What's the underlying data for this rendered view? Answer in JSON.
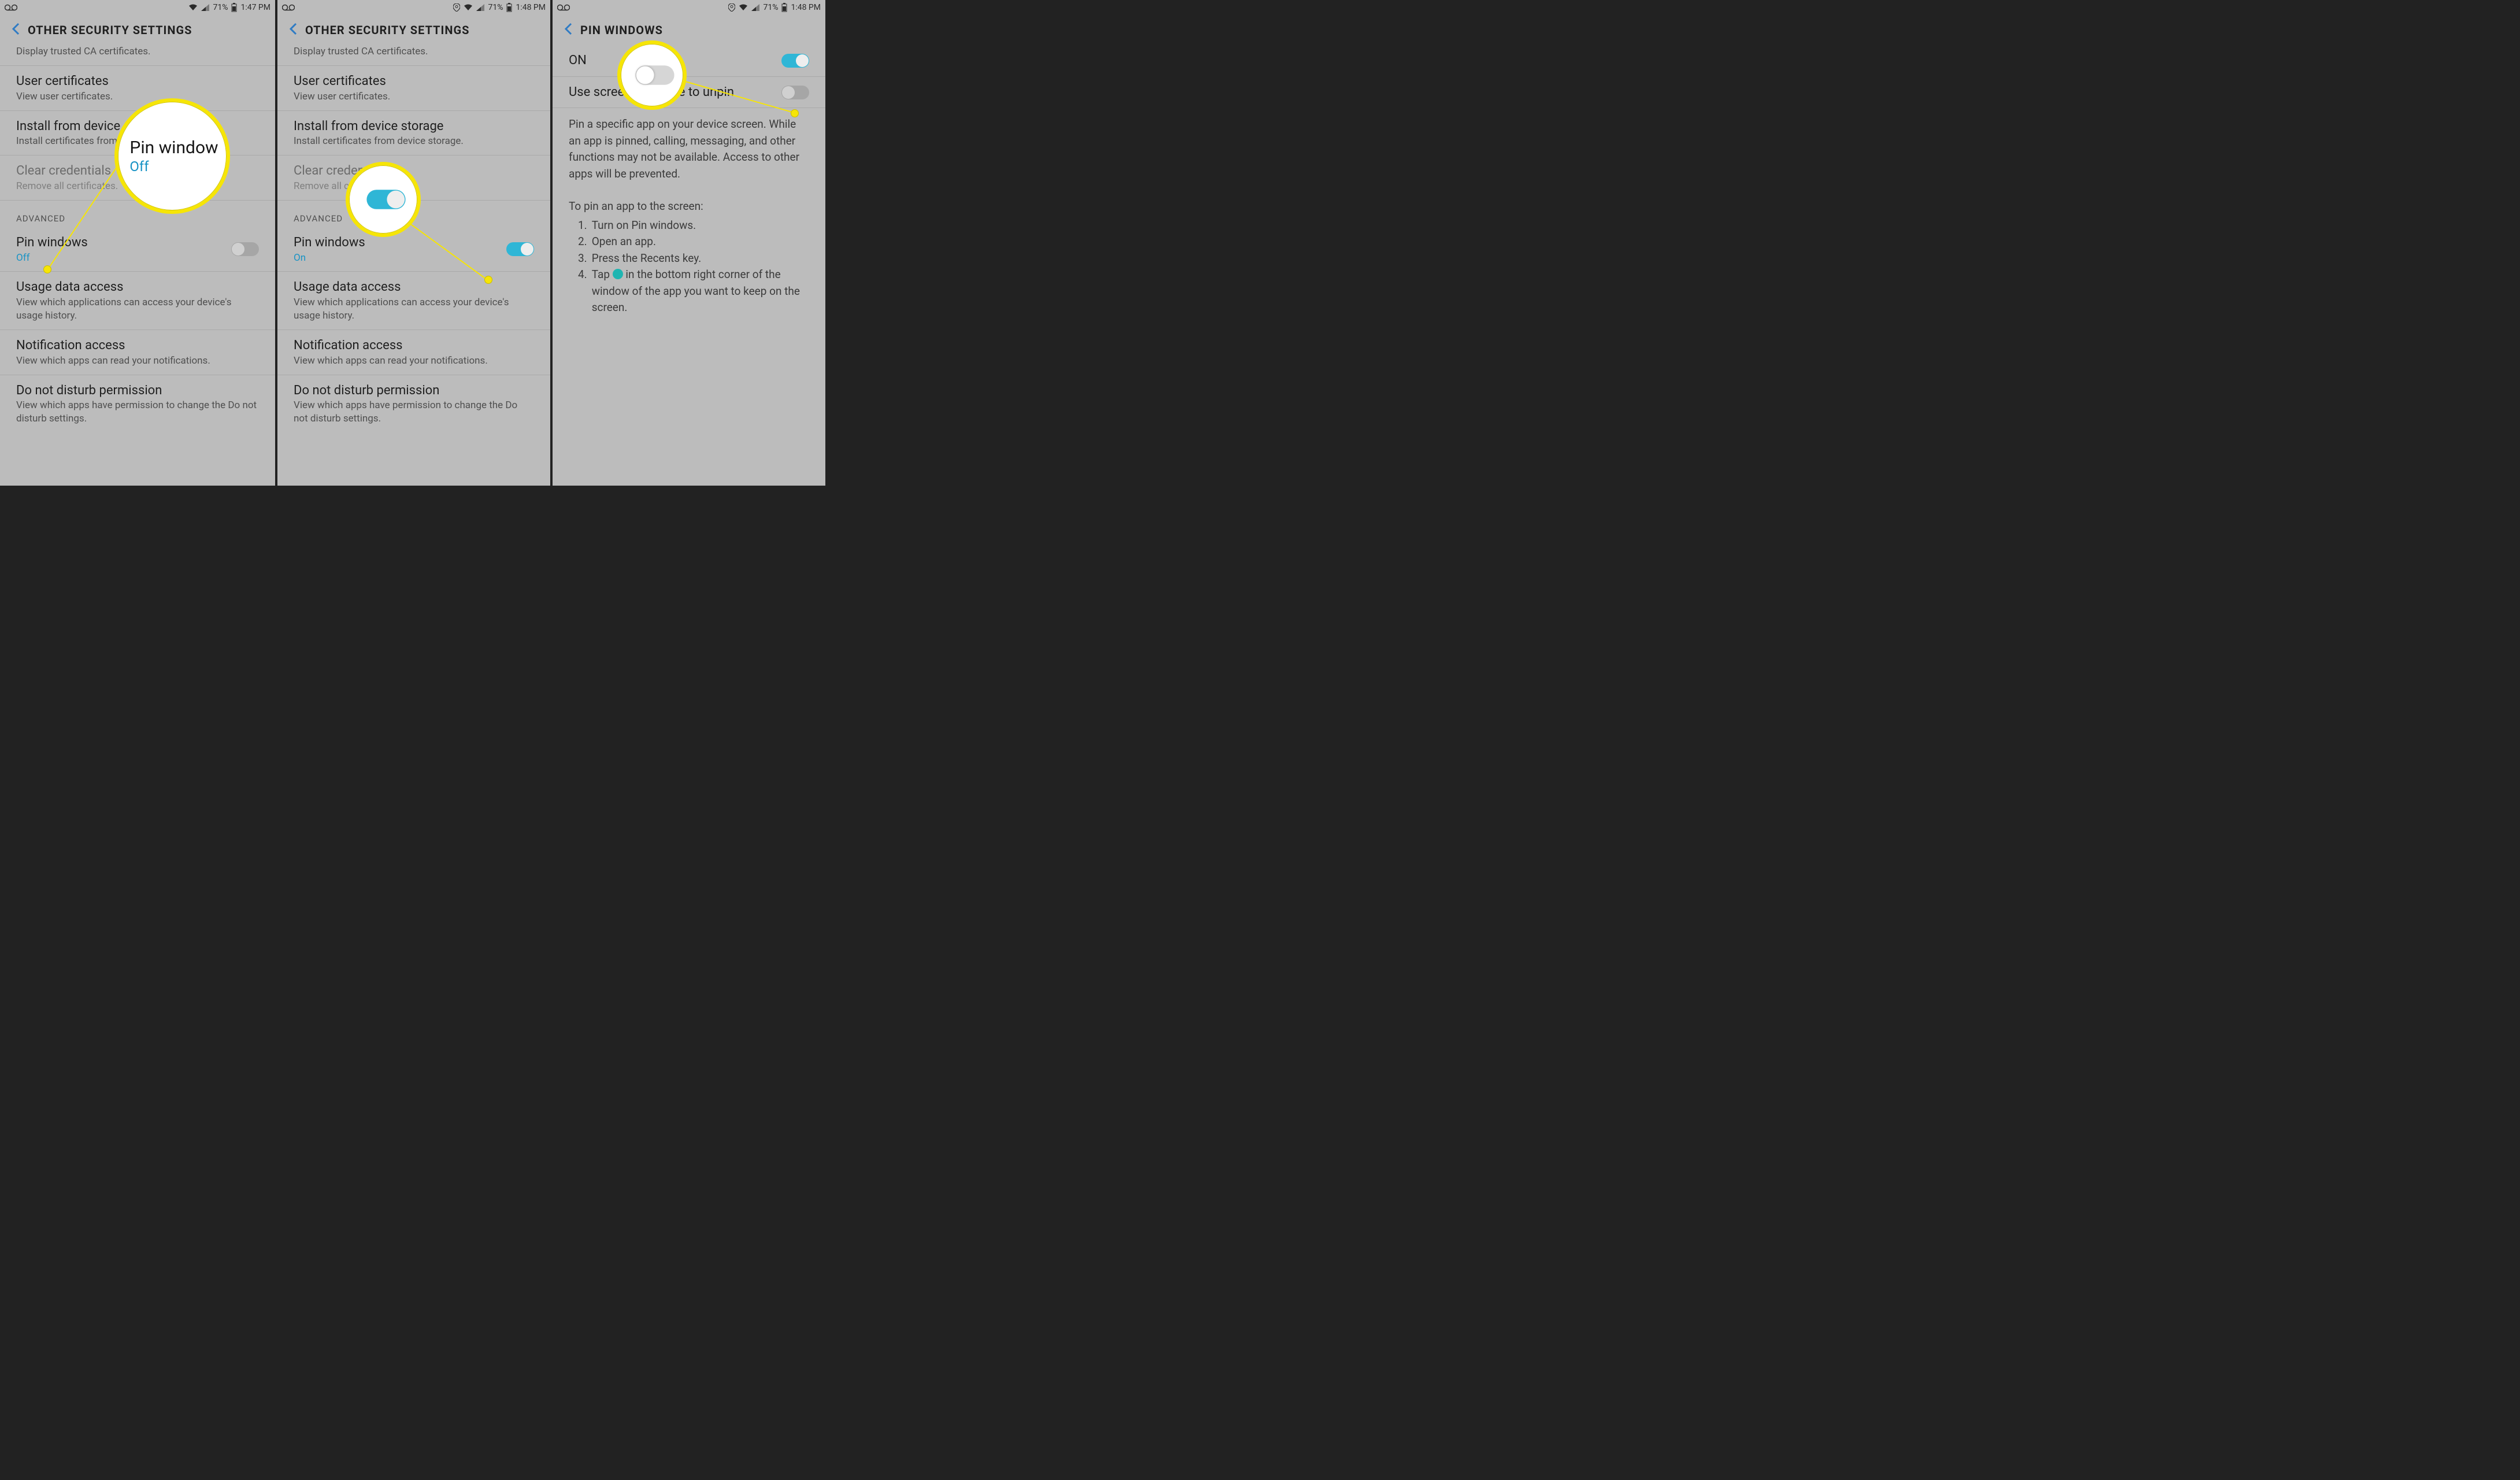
{
  "panels": [
    {
      "status": {
        "battery": "71%",
        "time": "1:47 PM",
        "show_location": false
      },
      "header": "OTHER SECURITY SETTINGS",
      "cut_sub": "Display trusted CA certificates.",
      "items": {
        "user_cert": {
          "title": "User certificates",
          "sub": "View user certificates."
        },
        "install": {
          "title": "Install from device storage",
          "sub": "Install certificates from device storage."
        },
        "clear": {
          "title": "Clear credentials",
          "sub": "Remove all certificates."
        },
        "section": "ADVANCED",
        "pin": {
          "title": "Pin windows",
          "sub": "Off",
          "on": false
        },
        "usage": {
          "title": "Usage data access",
          "sub": "View which applications can access your device's usage history."
        },
        "notif": {
          "title": "Notification access",
          "sub": "View which apps can read your notifications."
        },
        "dnd": {
          "title": "Do not disturb permission",
          "sub": "View which apps have permission to change the Do not disturb settings."
        }
      },
      "callout": {
        "big_title": "Pin window",
        "big_sub": "Off"
      }
    },
    {
      "status": {
        "battery": "71%",
        "time": "1:48 PM",
        "show_location": true
      },
      "header": "OTHER SECURITY SETTINGS",
      "cut_sub": "Display trusted CA certificates.",
      "items": {
        "user_cert": {
          "title": "User certificates",
          "sub": "View user certificates."
        },
        "install": {
          "title": "Install from device storage",
          "sub": "Install certificates from device storage."
        },
        "clear": {
          "title": "Clear credentials",
          "sub": "Remove all certificates."
        },
        "section": "ADVANCED",
        "pin": {
          "title": "Pin windows",
          "sub": "On",
          "on": true
        },
        "usage": {
          "title": "Usage data access",
          "sub": "View which applications can access your device's usage history."
        },
        "notif": {
          "title": "Notification access",
          "sub": "View which apps can read your notifications."
        },
        "dnd": {
          "title": "Do not disturb permission",
          "sub": "View which apps have permission to change the Do not disturb settings."
        }
      }
    },
    {
      "status": {
        "battery": "71%",
        "time": "1:48 PM",
        "show_location": true
      },
      "header": "PIN WINDOWS",
      "on_label": "ON",
      "unpin": "Use screen lock type to unpin",
      "desc": "Pin a specific app on your device screen. While an app is pinned, calling, messaging, and other functions may not be available. Access to other apps will be prevented.",
      "howto_head": "To pin an app to the screen:",
      "steps": {
        "s1": "Turn on Pin windows.",
        "s2": "Open an app.",
        "s3": "Press the Recents key.",
        "s4a": "Tap ",
        "s4b": " in the bottom right corner of the window of the app you want to keep on the screen."
      }
    }
  ]
}
